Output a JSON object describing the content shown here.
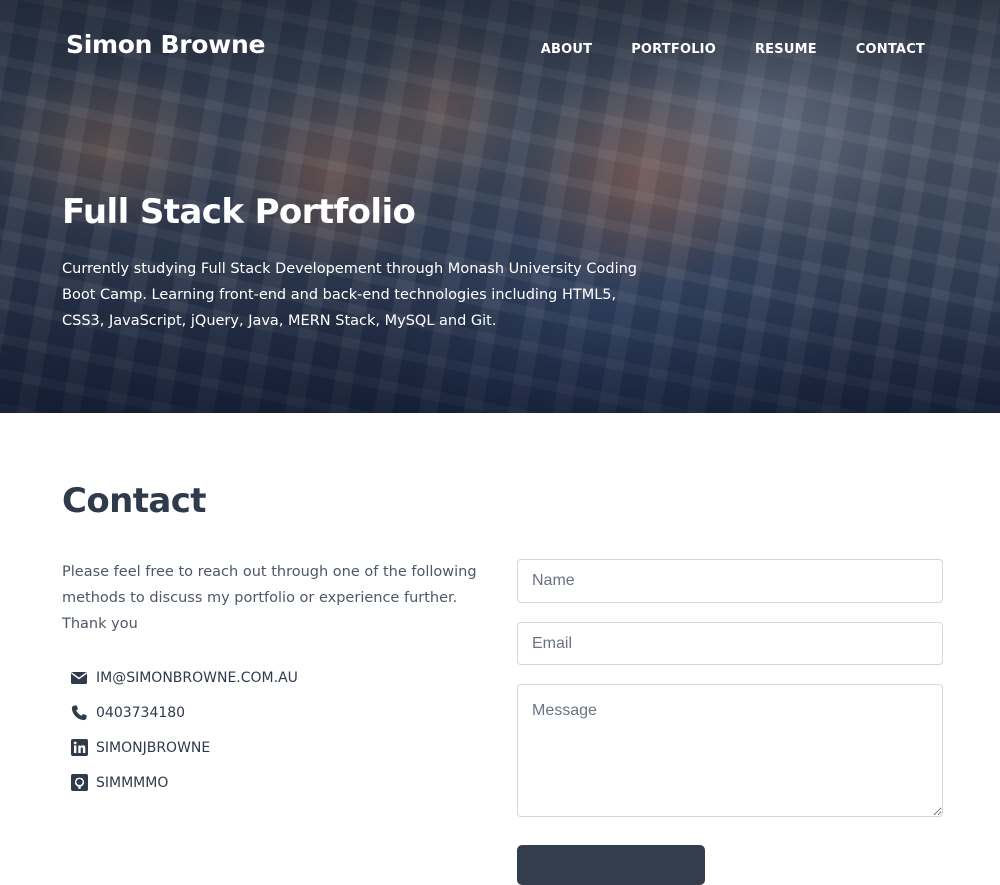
{
  "header": {
    "site_title": "Simon Browne",
    "nav": [
      {
        "label": "ABOUT"
      },
      {
        "label": "PORTFOLIO"
      },
      {
        "label": "RESUME"
      },
      {
        "label": "CONTACT"
      }
    ]
  },
  "hero": {
    "heading": "Full Stack Portfolio",
    "text": "Currently studying Full Stack Developement through Monash University Coding Boot Camp. Learning front-end and back-end technologies including HTML5, CSS3, JavaScript, jQuery, Java, MERN Stack, MySQL and Git."
  },
  "contact": {
    "heading": "Contact",
    "intro": "Please feel free to reach out through one of the following methods to discuss my portfolio or experience further. Thank you",
    "methods": [
      {
        "icon": "envelope-icon",
        "label": "IM@SIMONBROWNE.COM.AU"
      },
      {
        "icon": "phone-icon",
        "label": "0403734180"
      },
      {
        "icon": "linkedin-icon",
        "label": "SIMONJBROWNE"
      },
      {
        "icon": "github-icon",
        "label": "SIMMMMO"
      }
    ],
    "form": {
      "name_placeholder": "Name",
      "email_placeholder": "Email",
      "message_placeholder": "Message",
      "submit_label": ""
    }
  },
  "colors": {
    "text_dark": "#2f3a4a",
    "button_bg": "#333d4c",
    "input_border": "#d3d8de"
  }
}
